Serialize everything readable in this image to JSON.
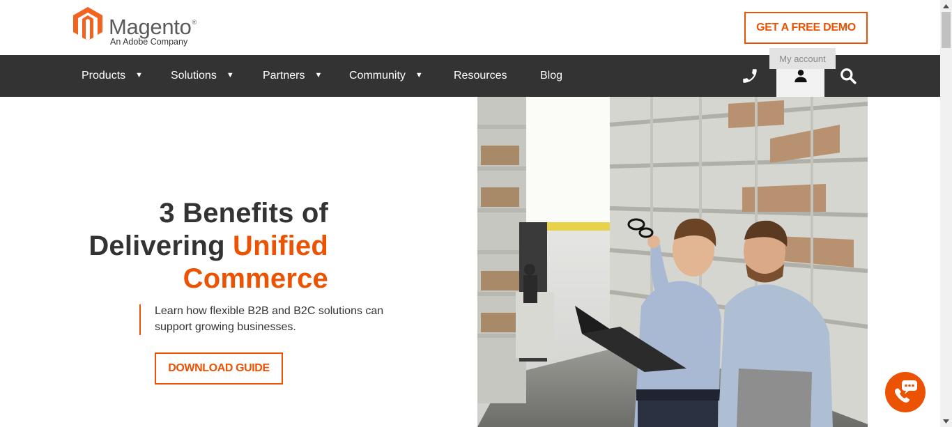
{
  "brand": {
    "name": "Magento",
    "tagline": "An Adobe Company",
    "color": "#eb5202"
  },
  "header": {
    "demo_label": "GET A FREE DEMO"
  },
  "nav": {
    "items": [
      {
        "label": "Products",
        "caret": "▼"
      },
      {
        "label": "Solutions",
        "caret": "▼"
      },
      {
        "label": "Partners",
        "caret": "▼"
      },
      {
        "label": "Community",
        "caret": "▼"
      },
      {
        "label": "Resources"
      },
      {
        "label": "Blog"
      }
    ],
    "icons": [
      "phone-icon",
      "account-icon",
      "search-icon"
    ],
    "account_tooltip": "My account",
    "background": "#333333"
  },
  "hero": {
    "title_line1": "3 Benefits of",
    "title_line2_plain": "Delivering ",
    "title_line2_accent": "Unified",
    "title_line3_accent": "Commerce",
    "description": "Learn how flexible B2B and B2C solutions can support growing businesses.",
    "cta_label": "DOWNLOAD GUIDE",
    "image_alt": "Two men in a warehouse looking at shelving"
  },
  "chat": {
    "icon": "chat-phone-icon"
  }
}
